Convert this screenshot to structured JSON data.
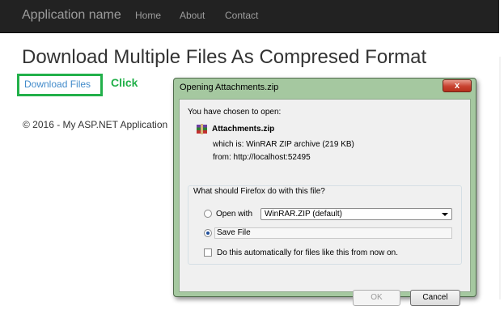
{
  "navbar": {
    "brand": "Application name",
    "links": [
      "Home",
      "About",
      "Contact"
    ]
  },
  "page": {
    "title": "Download Multiple Files As Compresed Format",
    "download_link": "Download Files",
    "annotation": "Click",
    "footer": "© 2016 - My ASP.NET Application"
  },
  "dialog": {
    "title": "Opening Attachments.zip",
    "close_label": "x",
    "intro": "You have chosen to open:",
    "file_name": "Attachments.zip",
    "which_is": "which is:  WinRAR ZIP archive (219 KB)",
    "from": "from:  http://localhost:52495",
    "question": "What should Firefox do with this file?",
    "open_with_label": "Open with",
    "open_with_value": "WinRAR.ZIP (default)",
    "save_file_label": "Save File",
    "auto_label": "Do this automatically for files like this from now on.",
    "ok_label": "OK",
    "cancel_label": "Cancel",
    "selected_option": "save_file"
  },
  "colors": {
    "navbar_bg": "#222222",
    "link_blue": "#428bca",
    "annotation_green": "#22b04a",
    "dialog_frame": "#a5c8a0"
  }
}
